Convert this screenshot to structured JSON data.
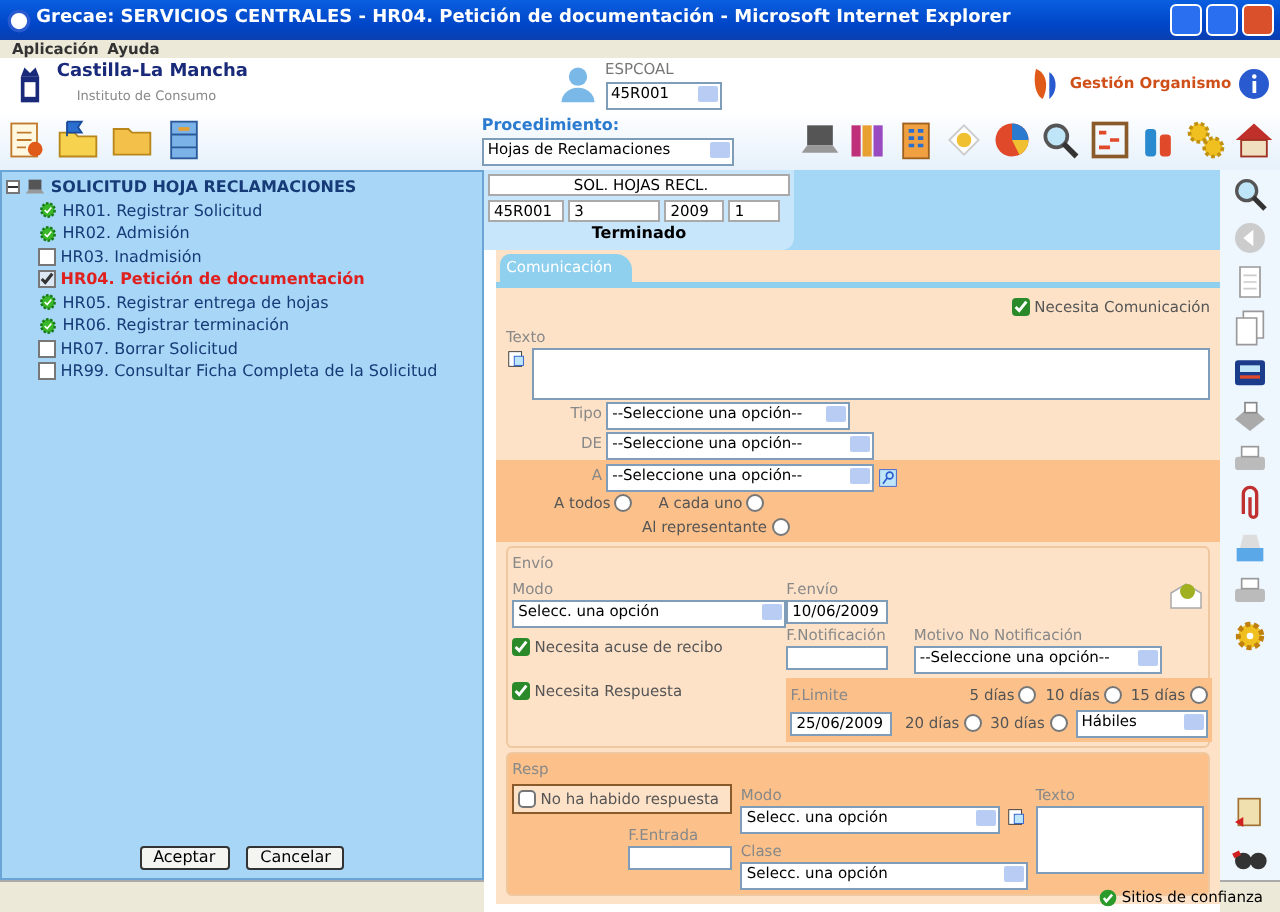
{
  "window": {
    "title": "Grecae: SERVICIOS CENTRALES - HR04. Petición de documentación - Microsoft Internet Explorer"
  },
  "menu": [
    "Aplicación",
    "Ayuda"
  ],
  "header": {
    "logo_title": "Castilla-La Mancha",
    "logo_subtitle": "Instituto de Consumo",
    "user_label": "ESPCOAL",
    "user_value": "45R001",
    "organism": "Gestión Organismo"
  },
  "procedure": {
    "label": "Procedimiento:",
    "value": "Hojas de Reclamaciones"
  },
  "tree": {
    "title": "SOLICITUD HOJA RECLAMACIONES",
    "expanded": true,
    "children": [
      {
        "label": "HR01. Registrar Solicitud",
        "kind": "done",
        "selected": false
      },
      {
        "label": "HR02. Admisión",
        "kind": "done",
        "selected": false
      },
      {
        "label": "HR03. Inadmisión",
        "kind": "checkbox",
        "checked": false,
        "selected": false
      },
      {
        "label": "HR04. Petición de documentación",
        "kind": "checkbox",
        "checked": true,
        "selected": true
      },
      {
        "label": "HR05. Registrar entrega de hojas",
        "kind": "done",
        "selected": false
      },
      {
        "label": "HR06. Registrar terminación",
        "kind": "done",
        "selected": false
      },
      {
        "label": "HR07. Borrar Solicitud",
        "kind": "checkbox",
        "checked": false,
        "selected": false
      },
      {
        "label": "HR99. Consultar Ficha Completa de la Solicitud",
        "kind": "checkbox",
        "checked": false,
        "selected": false
      }
    ],
    "buttons": [
      "Aceptar",
      "Cancelar"
    ]
  },
  "record": {
    "title": "SOL. HOJAS RECL.",
    "fields": [
      "45R001",
      "3",
      "2009",
      "1"
    ],
    "status": "Terminado"
  },
  "tabs": [
    {
      "label": "Comunicación",
      "selected": true
    }
  ],
  "needs_communication": {
    "label": "Necesita Comunicación",
    "checked": true
  },
  "texto": {
    "label": "Texto"
  },
  "tipo": {
    "label": "Tipo",
    "value": "--Seleccione una opción--"
  },
  "de": {
    "label": "DE",
    "value": "--Seleccione una opción--"
  },
  "a": {
    "label": "A",
    "value": "--Seleccione una opción--"
  },
  "recipients": [
    {
      "label": "A todos",
      "selected": false
    },
    {
      "label": "A cada uno",
      "selected": false
    },
    {
      "label": "Al representante",
      "selected": false
    }
  ],
  "envio": {
    "legend": "Envío",
    "modo_label": "Modo",
    "modo_value": "Selecc. una opción",
    "fenvio_label": "F.envío",
    "fenvio_value": "10/06/2009",
    "fnotif_label": "F.Notificación",
    "motivo_label": "Motivo No Notificación",
    "motivo_value": "--Seleccione una opción--",
    "acuse": {
      "label": "Necesita acuse de recibo",
      "checked": true
    },
    "respuesta": {
      "label": "Necesita Respuesta",
      "checked": true
    },
    "flimite_label": "F.Limite",
    "flimite_value": "25/06/2009",
    "days": [
      {
        "label": "5 días",
        "selected": false
      },
      {
        "label": "10 días",
        "selected": false
      },
      {
        "label": "15 días",
        "selected": false
      },
      {
        "label": "20 días",
        "selected": false
      },
      {
        "label": "30 días",
        "selected": false
      }
    ],
    "day_type": "Hábiles"
  },
  "resp": {
    "legend": "Resp",
    "no_response": {
      "label": "No ha habido respuesta",
      "checked": false
    },
    "modo_label": "Modo",
    "modo_value": "Selecc. una opción",
    "texto_label": "Texto",
    "fentrada_label": "F.Entrada",
    "clase_label": "Clase",
    "clase_value": "Selecc. una opción"
  },
  "status_bar": {
    "zone": "Sitios de confianza"
  }
}
